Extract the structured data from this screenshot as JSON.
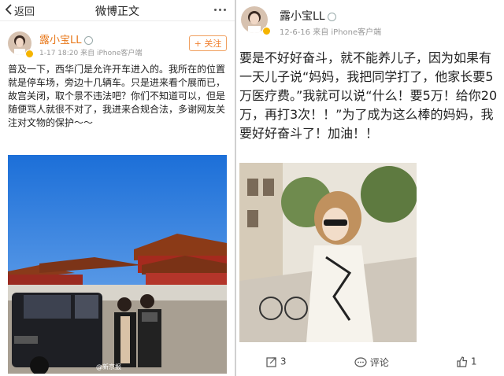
{
  "left": {
    "topbar": {
      "back_label": "返回",
      "title": "微博正文"
    },
    "user": {
      "name": "露小宝LL",
      "time": "1-17 18:20",
      "source": "来自 iPhone客户端"
    },
    "follow_label": "+ 关注",
    "text": "普及一下，西华门是允许开车进入的。我所在的位置就是停车场，旁边十几辆车。只是进来看个展而已，故宫关闭，取个景不违法吧？你们不知道可以，但是随便骂人就很不对了，我进来合规合法，多谢网友关注对文物的保护～～",
    "photo_watermark": "@新京报"
  },
  "right": {
    "user": {
      "name": "露小宝LL",
      "time": "12-6-16",
      "source": "来自 iPhone客户端"
    },
    "text": "要是不好好奋斗，就不能养儿子，因为如果有一天儿子说“妈妈，我把同学打了，他家长要5万医疗费。”我就可以说“什么！要5万！给你20万，再打3次！！”为了成为这么棒的妈妈，我要好好奋斗了！加油！！",
    "actions": {
      "repost_count": "3",
      "comment_label": "评论",
      "like_count": "1"
    }
  },
  "colors": {
    "orange": "#e8781a",
    "follow_border": "#f0a060",
    "text": "#222222",
    "meta": "#999999"
  }
}
